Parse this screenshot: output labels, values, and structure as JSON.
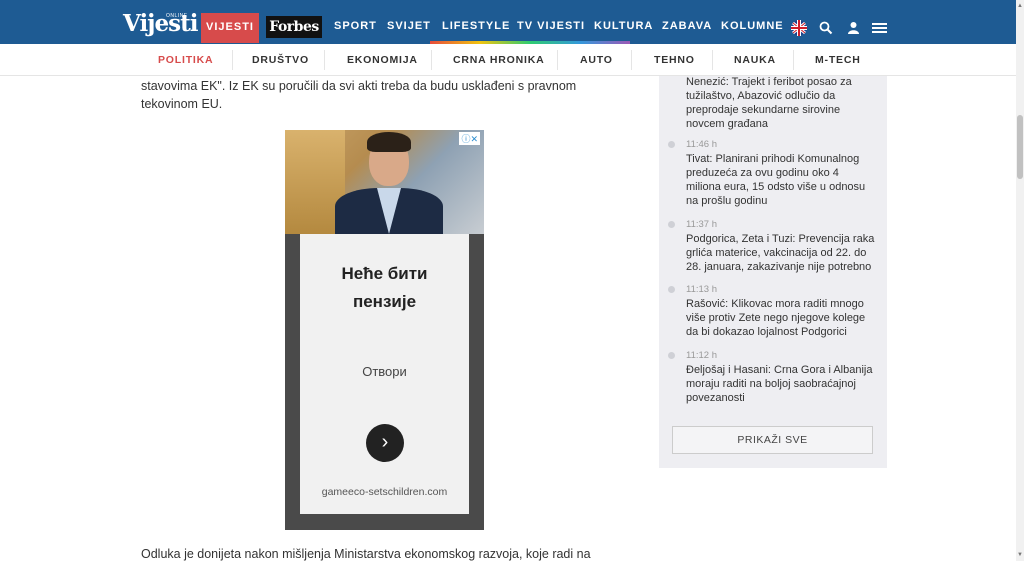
{
  "header": {
    "logo": "Vijesti",
    "logo_small": "ONLINE",
    "nav_active": "VIJESTI",
    "forbes": "Forbes",
    "nav": [
      "SPORT",
      "SVIJET",
      "LIFESTYLE",
      "TV VIJESTI",
      "KULTURA",
      "ZABAVA",
      "KOLUMNE"
    ],
    "icons": [
      "uk-flag-icon",
      "search-icon",
      "user-icon",
      "menu-icon"
    ],
    "colors": {
      "bar": "#1e5b93",
      "accent": "#d74b4b"
    }
  },
  "subnav": [
    "POLITIKA",
    "DRUŠTVO",
    "EKONOMIJA",
    "CRNA HRONIKA",
    "AUTO",
    "TEHNO",
    "NAUKA",
    "M-TECH"
  ],
  "article": {
    "para1_line1": "stavovima EK\". Iz EK su poručili da svi akti treba da budu usklađeni s pravnom",
    "para1_line2": "tekovinom EU.",
    "para2": "Odluka je donijeta nakon mišljenja Ministarstva ekonomskog razvoja, koje radi na"
  },
  "ad": {
    "title_line1": "Неће бити",
    "title_line2": "пензије",
    "open": "Отвори",
    "domain": "gameeco-setschildren.com",
    "adchoice": "ⓘ✕"
  },
  "sidebar": {
    "items": [
      {
        "time": "",
        "title": "Nenezić: Trajekt i feribot posao za tužilaštvo, Abazović odlučio da preprodaje sekundarne sirovine novcem građana"
      },
      {
        "time": "11:46 h",
        "title": "Tivat: Planirani prihodi Komunalnog preduzeća za ovu godinu oko 4 miliona eura, 15 odsto više u odnosu na prošlu godinu"
      },
      {
        "time": "11:37 h",
        "title": "Podgorica, Zeta i Tuzi: Prevencija raka grlića materice, vakcinacija od 22. do 28. januara, zakazivanje nije potrebno"
      },
      {
        "time": "11:13 h",
        "title": "Rašović: Klikovac mora raditi mnogo više protiv Zete nego njegove kolege da bi dokazao lojalnost Podgorici"
      },
      {
        "time": "11:12 h",
        "title": "Đeljošaj i Hasani: Crna Gora i Albanija moraju raditi na boljoj saobraćajnoj povezanosti"
      }
    ],
    "show_all": "PRIKAŽI SVE"
  }
}
